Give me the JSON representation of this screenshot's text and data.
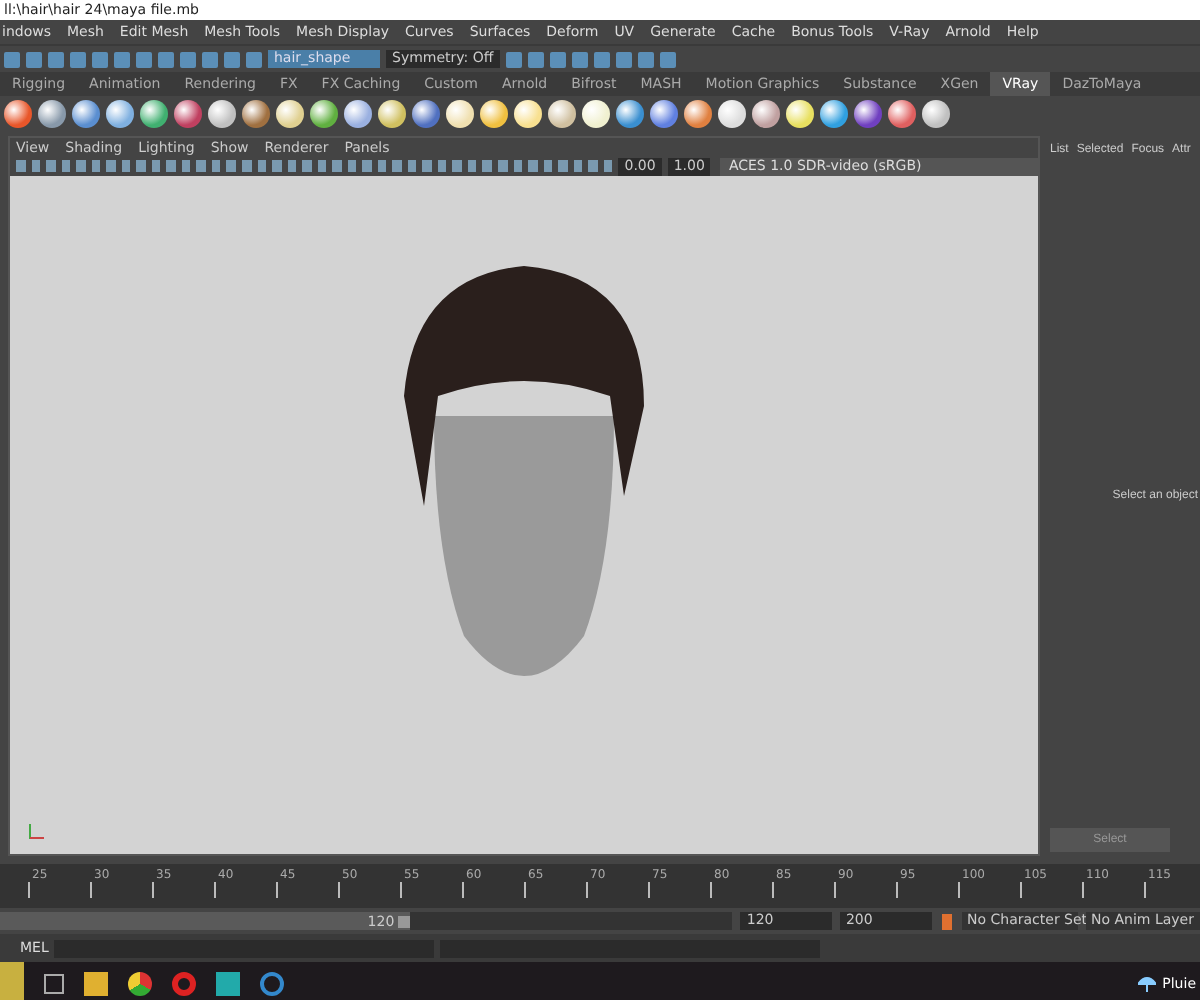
{
  "window": {
    "title": "ll:\\hair\\hair 24\\maya file.mb"
  },
  "menu_bar": [
    "indows",
    "Mesh",
    "Edit Mesh",
    "Mesh Tools",
    "Mesh Display",
    "Curves",
    "Surfaces",
    "Deform",
    "UV",
    "Generate",
    "Cache",
    "Bonus Tools",
    "V-Ray",
    "Arnold",
    "Help"
  ],
  "status_line": {
    "name_field": "hair_shape",
    "symmetry": "Symmetry: Off"
  },
  "shelf_tabs": [
    {
      "label": "Rigging",
      "selected": false
    },
    {
      "label": "Animation",
      "selected": false
    },
    {
      "label": "Rendering",
      "selected": false
    },
    {
      "label": "FX",
      "selected": false
    },
    {
      "label": "FX Caching",
      "selected": false
    },
    {
      "label": "Custom",
      "selected": false
    },
    {
      "label": "Arnold",
      "selected": false
    },
    {
      "label": "Bifrost",
      "selected": false
    },
    {
      "label": "MASH",
      "selected": false
    },
    {
      "label": "Motion Graphics",
      "selected": false
    },
    {
      "label": "Substance",
      "selected": false
    },
    {
      "label": "XGen",
      "selected": false
    },
    {
      "label": "VRay",
      "selected": true
    },
    {
      "label": "DazToMaya",
      "selected": false
    }
  ],
  "viewport": {
    "menus": [
      "View",
      "Shading",
      "Lighting",
      "Show",
      "Renderer",
      "Panels"
    ],
    "exposure": "0.00",
    "gamma": "1.00",
    "color_space": "ACES 1.0 SDR-video (sRGB)"
  },
  "side_panel": {
    "tabs": [
      "List",
      "Selected",
      "Focus",
      "Attr"
    ],
    "message": "Select an object",
    "button": "Select"
  },
  "timeline": {
    "ticks": [
      "25",
      "30",
      "35",
      "40",
      "45",
      "50",
      "55",
      "60",
      "65",
      "70",
      "75",
      "80",
      "85",
      "90",
      "95",
      "100",
      "105",
      "110",
      "115"
    ]
  },
  "range": {
    "level": 0.56,
    "slider_end": "120",
    "end": "120",
    "max": "200",
    "character_set": "No Character Set",
    "anim_layer": "No Anim Layer"
  },
  "command_line": {
    "label": "MEL"
  },
  "taskbar": {
    "weather": "Pluie"
  }
}
